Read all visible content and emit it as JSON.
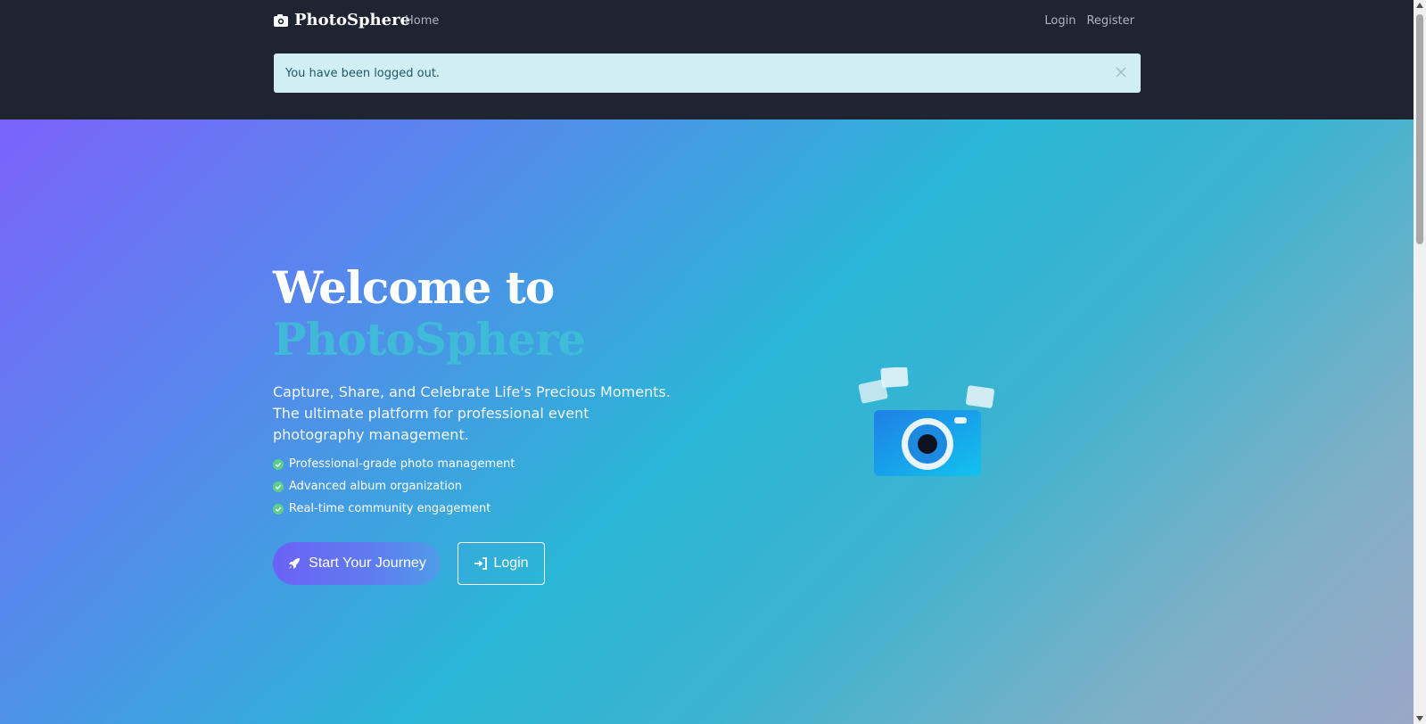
{
  "navbar": {
    "brand": "PhotoSphere",
    "brand_icon": "camera-icon",
    "home_label": "Home",
    "login_label": "Login",
    "register_label": "Register"
  },
  "alert": {
    "message": "You have been logged out.",
    "close_icon": "close-icon"
  },
  "hero": {
    "title_line1": "Welcome to",
    "title_line2": "PhotoSphere",
    "subtitle": "Capture, Share, and Celebrate Life's Precious Moments. The ultimate platform for professional event photography management.",
    "features": [
      "Professional-grade photo management",
      "Advanced album organization",
      "Real-time community engagement"
    ],
    "primary_button": "Start Your Journey",
    "secondary_button": "Login",
    "illustration": "camera-illustration"
  },
  "colors": {
    "navbar_bg": "#1f2433",
    "alert_bg": "#d1eef5",
    "accent": "#3dc2d6",
    "check": "#5ecf8a"
  }
}
